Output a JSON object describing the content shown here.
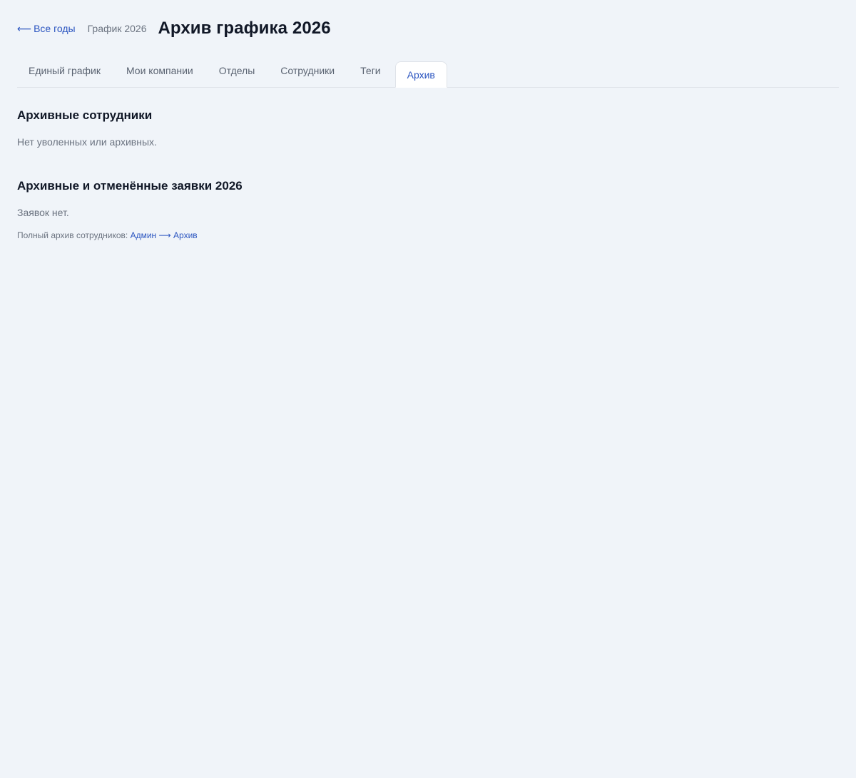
{
  "header": {
    "back_arrow": "⟵",
    "back_label": "Все годы",
    "breadcrumb": "График 2026",
    "title": "Архив графика 2026"
  },
  "tabs": [
    {
      "label": "Единый график",
      "active": false
    },
    {
      "label": "Мои компании",
      "active": false
    },
    {
      "label": "Отделы",
      "active": false
    },
    {
      "label": "Сотрудники",
      "active": false
    },
    {
      "label": "Теги",
      "active": false
    },
    {
      "label": "Архив",
      "active": true
    }
  ],
  "archived_employees": {
    "title": "Архивные сотрудники",
    "empty_text": "Нет уволенных или архивных."
  },
  "archived_requests": {
    "title": "Архивные и отменённые заявки 2026",
    "empty_text": "Заявок нет."
  },
  "footnote": {
    "prefix": "Полный архив сотрудников: ",
    "link_label": "Админ ⟶ Архив"
  },
  "colors": {
    "background": "#f0f4f9",
    "accent": "#2b55c0",
    "text": "#111827",
    "muted": "#6b7380"
  }
}
